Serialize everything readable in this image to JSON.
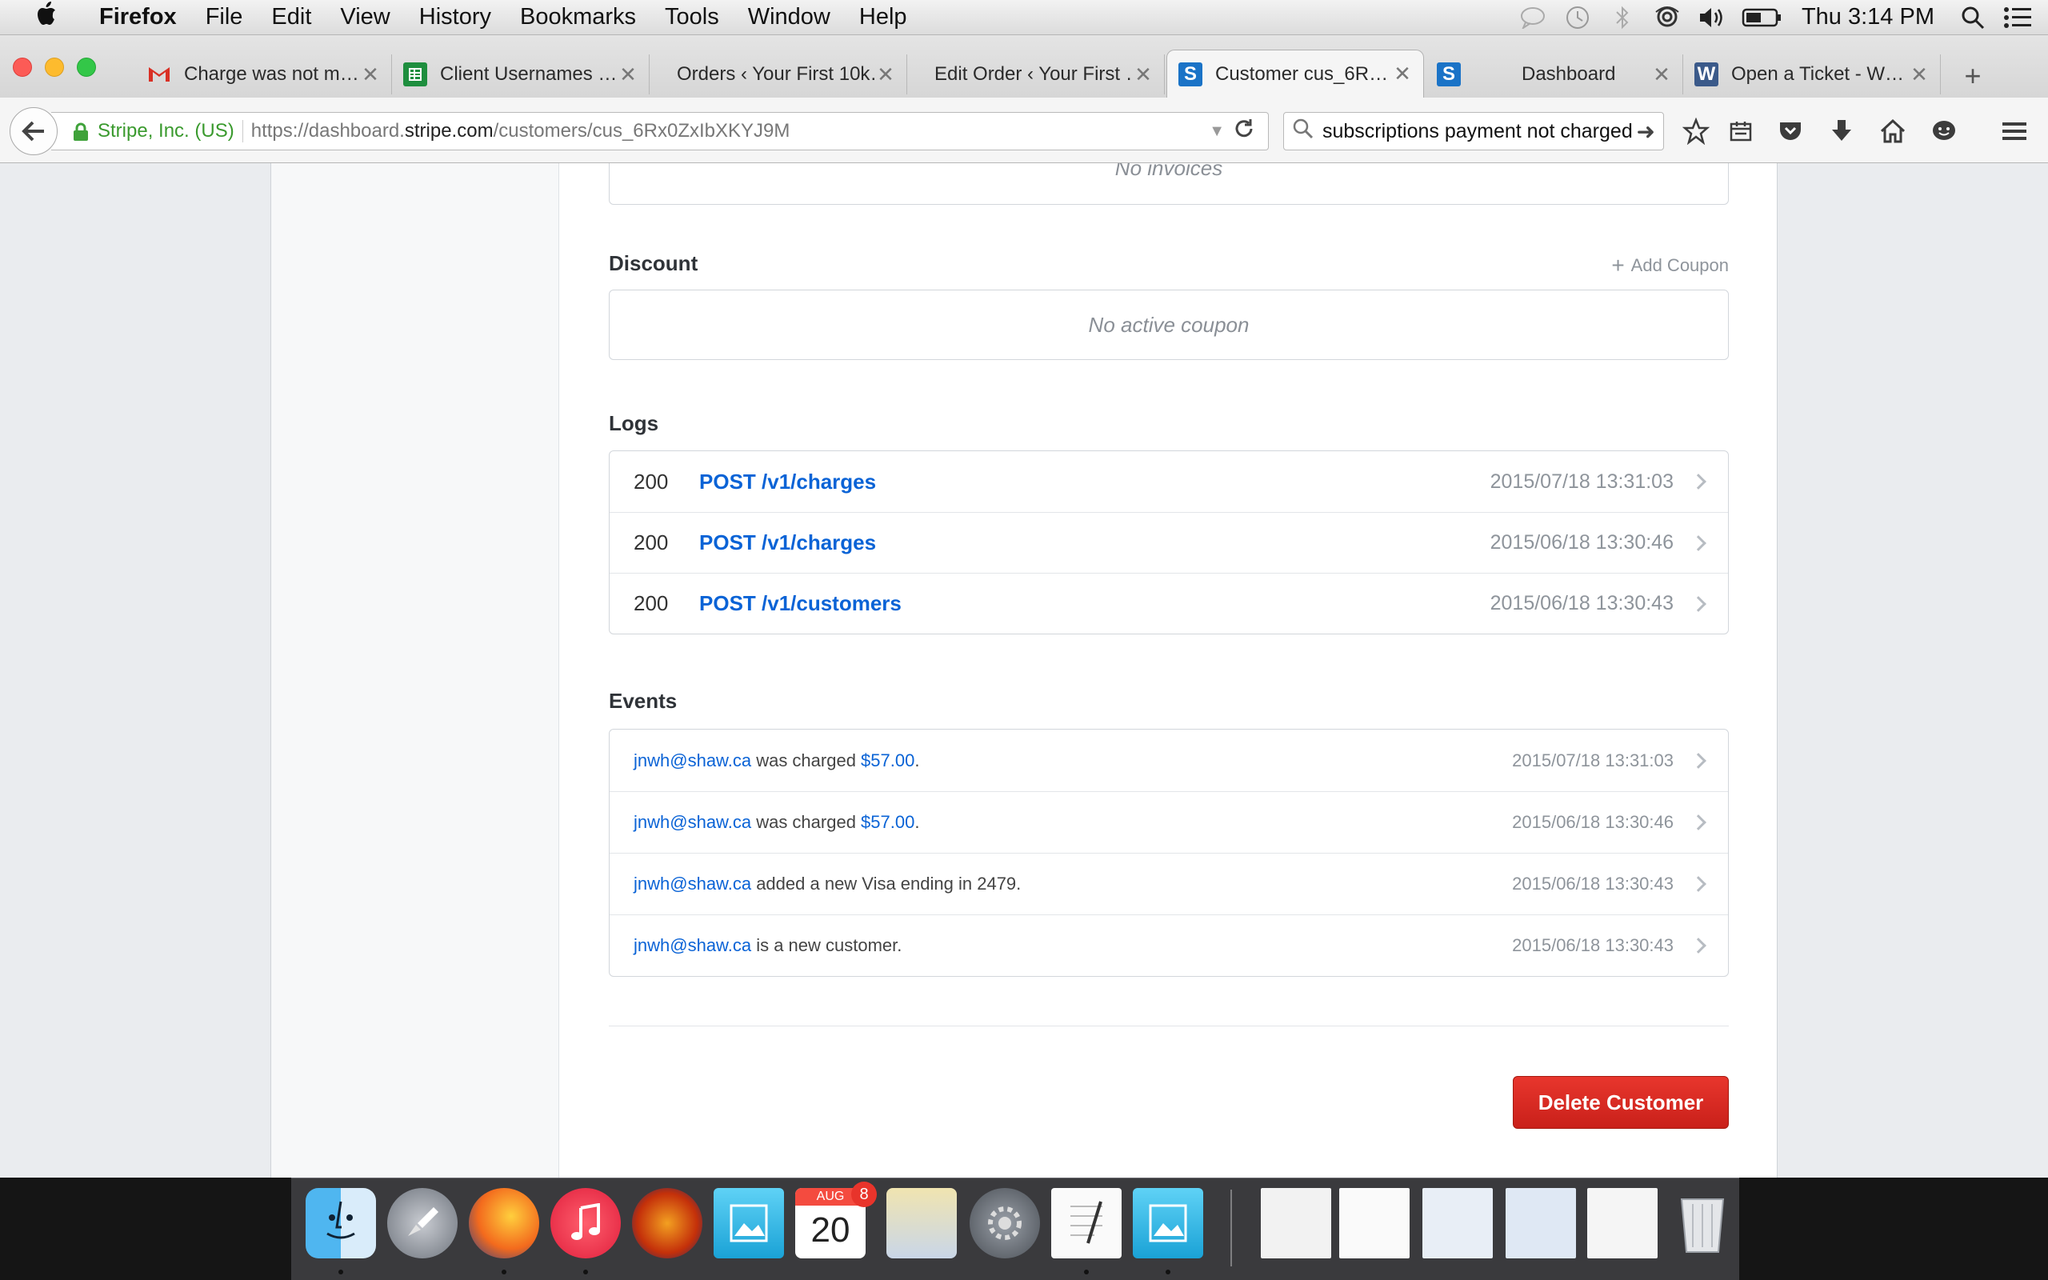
{
  "menubar": {
    "apple": "",
    "app": "Firefox",
    "items": [
      "File",
      "Edit",
      "View",
      "History",
      "Bookmarks",
      "Tools",
      "Window",
      "Help"
    ],
    "clock": "Thu 3:14 PM",
    "status_icons": [
      "messages-icon",
      "time-machine-icon",
      "bluetooth-icon",
      "airplay-icon",
      "volume-icon",
      "battery-icon",
      "spotlight-icon",
      "notification-center-icon"
    ]
  },
  "tabs": [
    {
      "title": "Charge was not m…",
      "icon": "gmail-icon",
      "color": "#d93025"
    },
    {
      "title": "Client Usernames …",
      "icon": "sheets-icon",
      "color": "#1e8e3e"
    },
    {
      "title": "Orders ‹ Your First 10k…",
      "icon": "",
      "color": ""
    },
    {
      "title": "Edit Order ‹ Your First …",
      "icon": "",
      "color": ""
    },
    {
      "title": "Customer cus_6R…",
      "icon": "stripe-icon",
      "color": "#1a73c7",
      "active": true
    },
    {
      "title": "Dashboard",
      "icon": "stripe-icon",
      "color": "#1a73c7"
    },
    {
      "title": "Open a Ticket - W…",
      "icon": "wordpress-icon",
      "color": "#3b5a8a"
    }
  ],
  "nav": {
    "org": "Stripe, Inc. (US)",
    "url_prefix": "https://dashboard.",
    "url_domain": "stripe.com",
    "url_path": "/customers/cus_6Rx0ZxIbXKYJ9M",
    "search_query": "subscriptions payment not charged"
  },
  "invoices": {
    "empty": "No invoices"
  },
  "discount": {
    "heading": "Discount",
    "add_label": "Add Coupon",
    "empty": "No active coupon"
  },
  "logs": {
    "heading": "Logs",
    "rows": [
      {
        "code": "200",
        "path": "POST /v1/charges",
        "ts": "2015/07/18 13:31:03"
      },
      {
        "code": "200",
        "path": "POST /v1/charges",
        "ts": "2015/06/18 13:30:46"
      },
      {
        "code": "200",
        "path": "POST /v1/customers",
        "ts": "2015/06/18 13:30:43"
      }
    ]
  },
  "events": {
    "heading": "Events",
    "rows": [
      {
        "email": "jnwh@shaw.ca",
        "pre": " was charged ",
        "amount": "$57.00",
        "post": ".",
        "ts": "2015/07/18 13:31:03"
      },
      {
        "email": "jnwh@shaw.ca",
        "pre": " was charged ",
        "amount": "$57.00",
        "post": ".",
        "ts": "2015/06/18 13:30:46"
      },
      {
        "email": "jnwh@shaw.ca",
        "pre": " added a new Visa ending in 2479.",
        "amount": "",
        "post": "",
        "ts": "2015/06/18 13:30:43"
      },
      {
        "email": "jnwh@shaw.ca",
        "pre": " is a new customer.",
        "amount": "",
        "post": "",
        "ts": "2015/06/18 13:30:43"
      }
    ]
  },
  "actions": {
    "delete_label": "Delete Customer"
  },
  "dock": {
    "calendar_month": "AUG",
    "calendar_day": "20",
    "calendar_badge": "8",
    "apps": [
      "finder-icon",
      "launchpad-icon",
      "firefox-icon",
      "itunes-icon",
      "audacity-icon",
      "preview-icon",
      "calendar-icon",
      "image-capture-icon",
      "system-preferences-icon",
      "textedit-icon",
      "preview-icon-2",
      "document-thumbnail-1",
      "document-thumbnail-2",
      "document-thumbnail-3",
      "document-thumbnail-4",
      "document-thumbnail-5",
      "trash-icon"
    ]
  }
}
